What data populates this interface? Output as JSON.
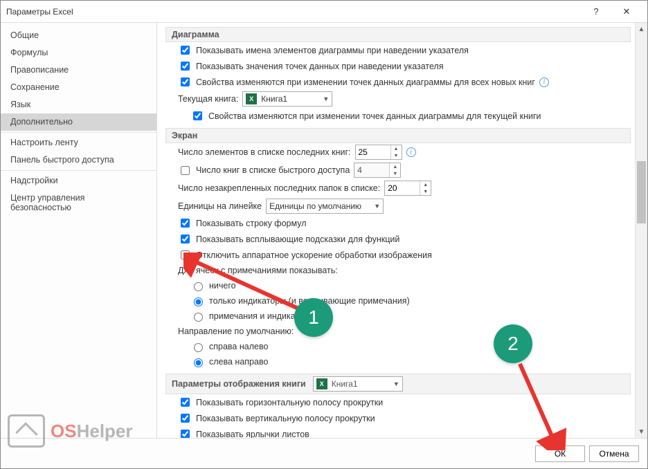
{
  "window": {
    "title": "Параметры Excel"
  },
  "sidebar": {
    "items": [
      "Общие",
      "Формулы",
      "Правописание",
      "Сохранение",
      "Язык",
      "Дополнительно",
      "Настроить ленту",
      "Панель быстрого доступа",
      "Надстройки",
      "Центр управления безопасностью"
    ],
    "selected_index": 5
  },
  "section_chart": {
    "title": "Диаграмма",
    "cb1": "Показывать имена элементов диаграммы при наведении указателя",
    "cb2": "Показывать значения точек данных при наведении указателя",
    "cb3": "Свойства изменяются при изменении точек данных диаграммы для всех новых книг",
    "current_book_label": "Текущая книга:",
    "current_book_value": "Книга1",
    "cb4": "Свойства изменяются при изменении точек данных диаграммы для текущей книги"
  },
  "section_screen": {
    "title": "Экран",
    "recent_docs_label": "Число элементов в списке последних книг:",
    "recent_docs_value": "25",
    "quick_access_cb": "Число книг в списке быстрого доступа",
    "quick_access_value": "4",
    "unpinned_label": "Число незакрепленных последних папок в списке:",
    "unpinned_value": "20",
    "ruler_units_label": "Единицы на линейке",
    "ruler_units_value": "Единицы по умолчанию",
    "cb_formula_bar": "Показывать строку формул",
    "cb_tooltips": "Показывать всплывающие подсказки для функций",
    "cb_hw_accel": "Отключить аппаратное ускорение обработки изображения",
    "comments_label": "Для ячеек с примечаниями показывать:",
    "comments_opt1": "ничего",
    "comments_opt2": "только индикаторы (и всплывающие примечания)",
    "comments_opt3": "примечания и индикаторы",
    "direction_label": "Направление по умолчанию:",
    "direction_opt1": "справа налево",
    "direction_opt2": "слева направо"
  },
  "section_display_book": {
    "title": "Параметры отображения книги",
    "book_value": "Книга1",
    "cb_hscroll": "Показывать горизонтальную полосу прокрутки",
    "cb_vscroll": "Показывать вертикальную полосу прокрутки",
    "cb_tabs": "Показывать ярлычки листов"
  },
  "footer": {
    "ok": "ОК",
    "cancel": "Отмена"
  },
  "annotations": {
    "badge1": "1",
    "badge2": "2"
  },
  "watermark": {
    "prefix": "OS",
    "suffix": "Helper"
  }
}
